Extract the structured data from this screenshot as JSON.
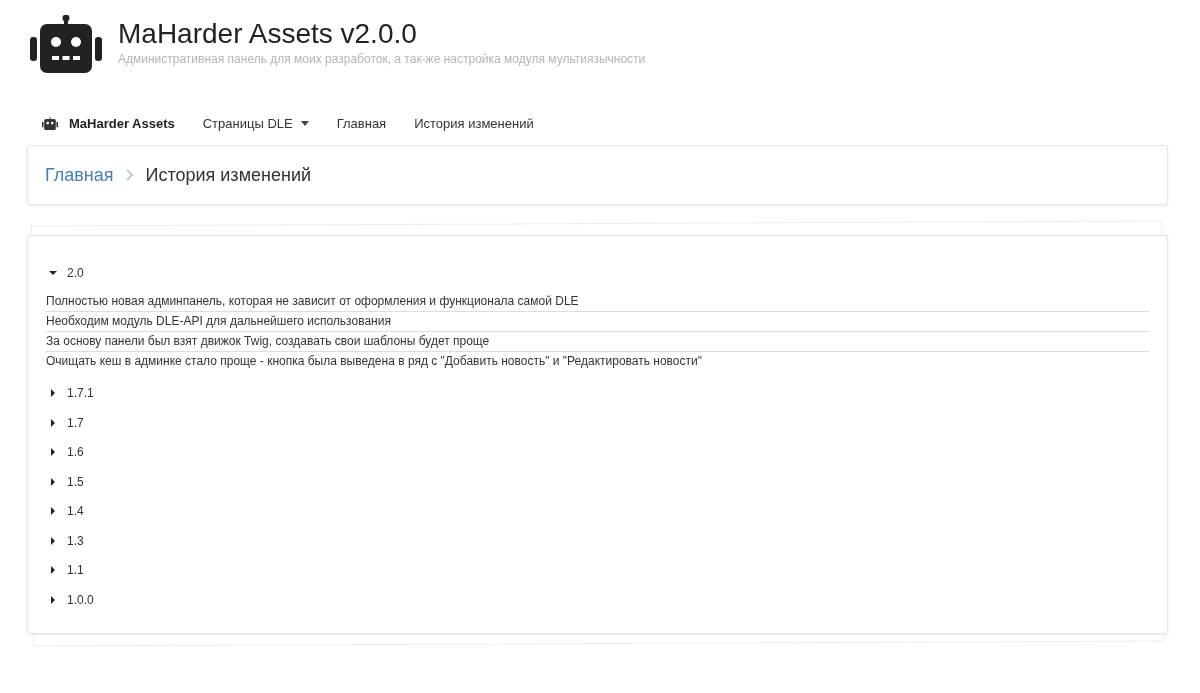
{
  "header": {
    "title": "MaHarder Assets v2.0.0",
    "subtitle": "Административная панель для моих разработок, а так-же настройка модуля мультиязычности"
  },
  "nav": [
    {
      "kind": "brand",
      "label": "MaHarder Assets"
    },
    {
      "kind": "dropdown",
      "label": "Страницы DLE"
    },
    {
      "kind": "link",
      "label": "Главная"
    },
    {
      "kind": "link",
      "label": "История изменений"
    }
  ],
  "breadcrumb": [
    {
      "label": "Главная",
      "kind": "link"
    },
    {
      "label": "История изменений",
      "kind": "current"
    }
  ],
  "versions": [
    {
      "label": "2.0",
      "expanded": true,
      "items": [
        "Полностью новая админпанель, которая не зависит от оформления и функционала самой DLE",
        "Необходим модуль DLE-API для дальнейшего использования",
        "За основу панели был взят движок Twig, создавать свои шаблоны будет проще",
        "Очищать кеш в админке стало проще - кнопка была выведена в ряд с \"Добавить новость\" и \"Редактировать новости\""
      ]
    },
    {
      "label": "1.7.1",
      "expanded": false
    },
    {
      "label": "1.7",
      "expanded": false
    },
    {
      "label": "1.6",
      "expanded": false
    },
    {
      "label": "1.5",
      "expanded": false
    },
    {
      "label": "1.4",
      "expanded": false
    },
    {
      "label": "1.3",
      "expanded": false
    },
    {
      "label": "1.1",
      "expanded": false
    },
    {
      "label": "1.0.0",
      "expanded": false
    }
  ]
}
